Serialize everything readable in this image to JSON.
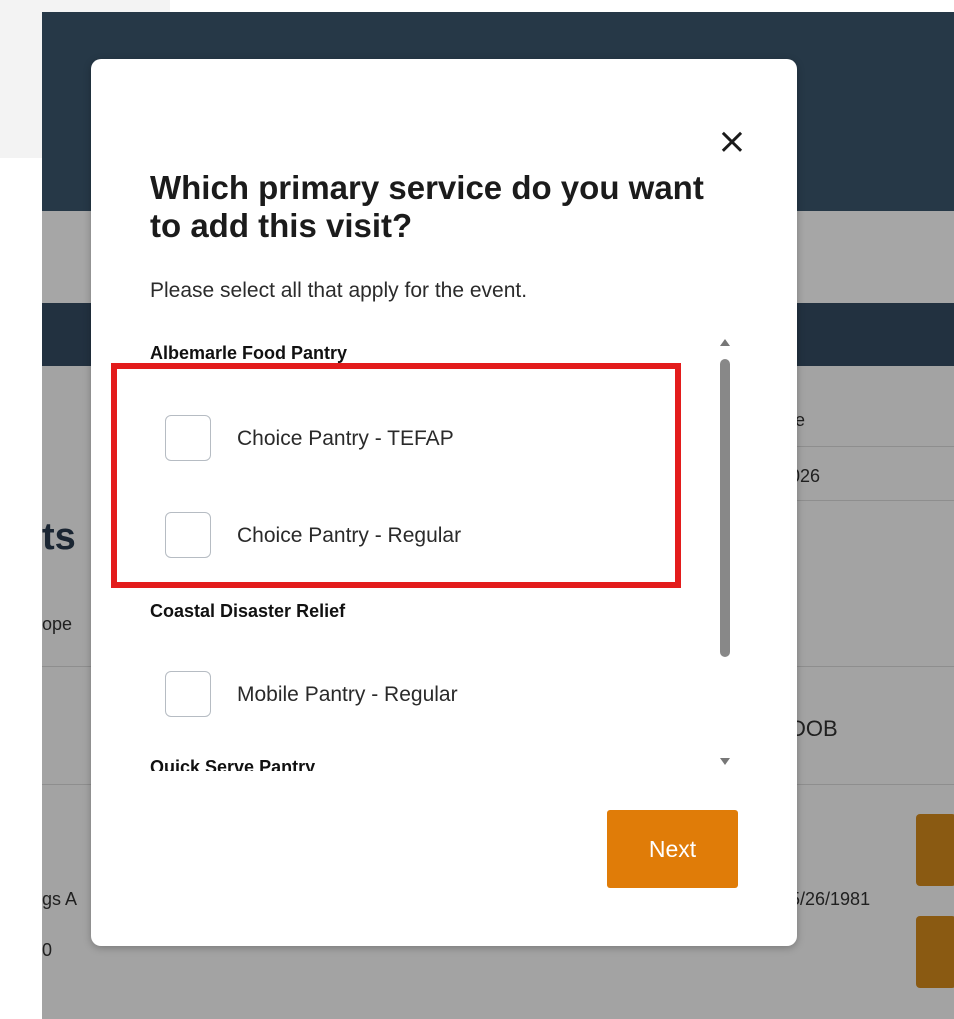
{
  "background": {
    "title_fragment": "ts",
    "subtitle_fragment": "ope",
    "col_header_fragment": "te",
    "col_value_fragment": "026",
    "dob_fragment": "DOB",
    "dob_value": "5/26/1981",
    "row_text_fragment": "gs A",
    "row_number_fragment": "0"
  },
  "modal": {
    "close_icon": "×",
    "title": "Which primary service do you want to add this visit?",
    "subtitle": "Please select all that apply for the event.",
    "groups": [
      {
        "label": "Albemarle Food Pantry",
        "options": [
          {
            "label": "Choice Pantry - TEFAP",
            "checked": false
          },
          {
            "label": "Choice Pantry - Regular",
            "checked": false
          }
        ]
      },
      {
        "label": "Coastal Disaster Relief",
        "options": [
          {
            "label": "Mobile Pantry - Regular",
            "checked": false
          }
        ]
      },
      {
        "label": "Quick Serve Pantry",
        "options": []
      }
    ],
    "next_label": "Next"
  },
  "colors": {
    "header_bg": "#263847",
    "overlay_gray": "#a3a3a3",
    "accent_orange": "#e07c08",
    "highlight_red": "#e31c1c"
  }
}
